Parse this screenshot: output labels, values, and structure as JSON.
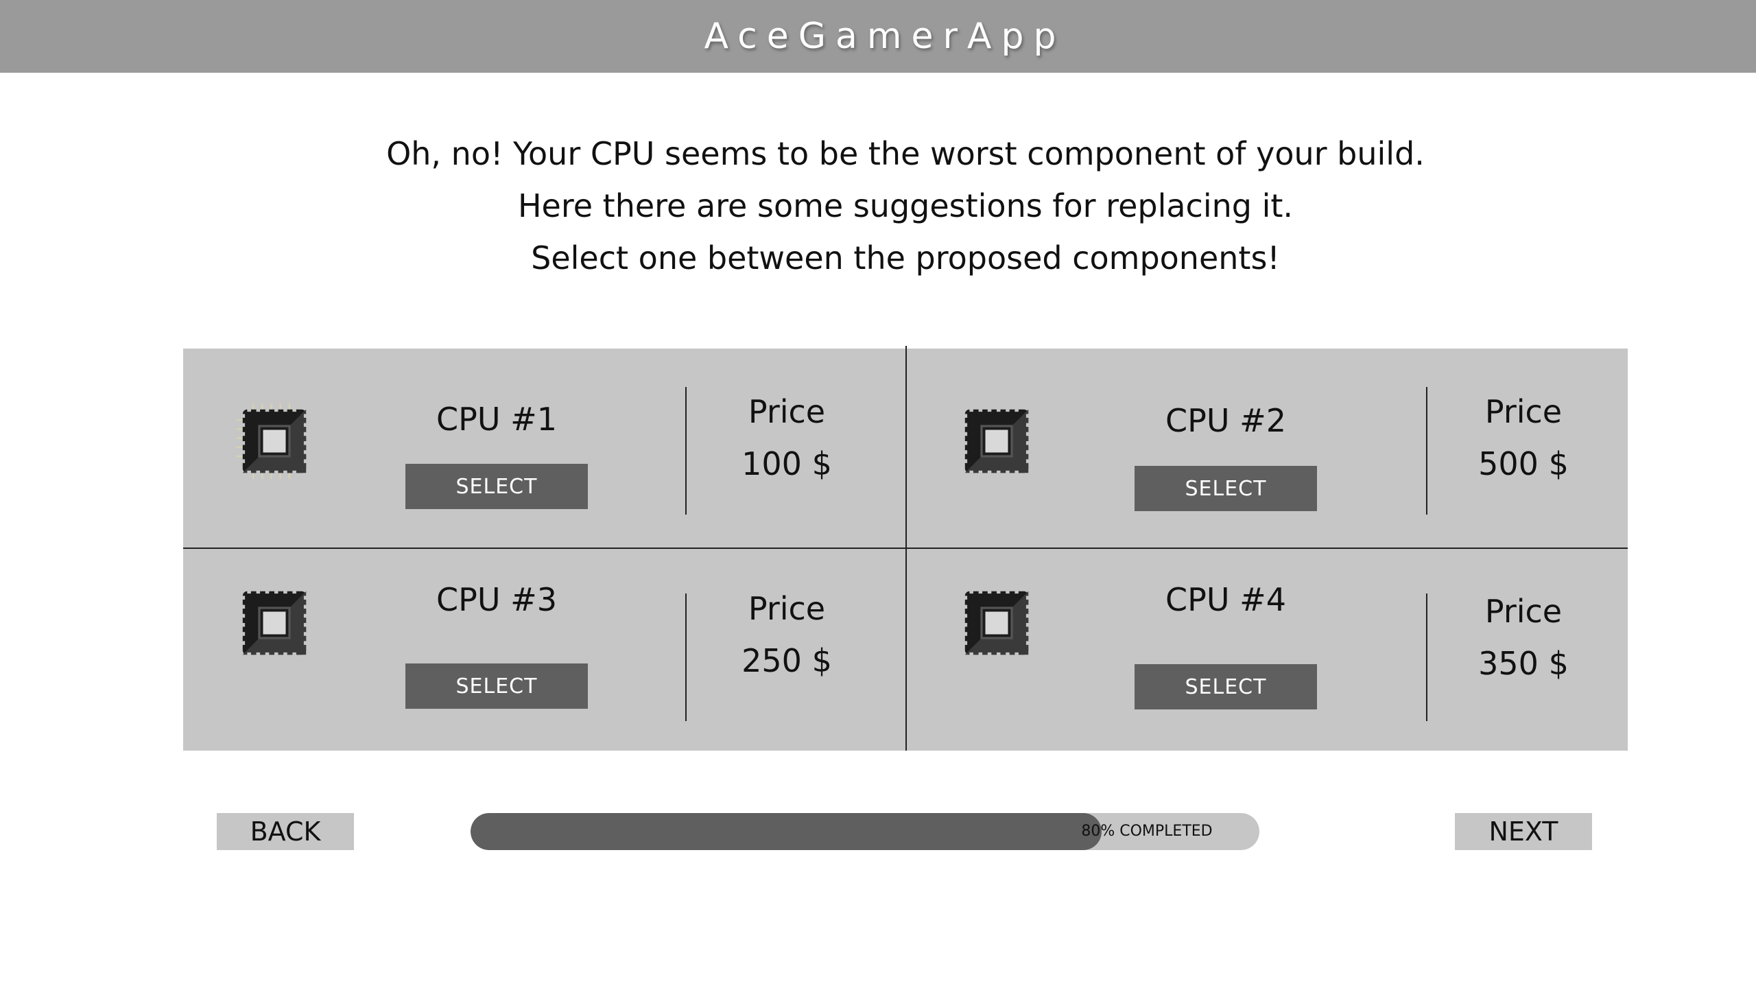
{
  "app": {
    "title": "AceGamerApp"
  },
  "message": {
    "lines": [
      "Oh, no! Your CPU seems to be the worst component of your build.",
      "Here there are some suggestions for replacing it.",
      "Select one between the proposed components!"
    ]
  },
  "options": [
    {
      "name": "CPU #1",
      "select_label": "SELECT",
      "price_label": "Price",
      "price": "100 $",
      "icon": "cpu-chip-icon"
    },
    {
      "name": "CPU #2",
      "select_label": "SELECT",
      "price_label": "Price",
      "price": "500 $",
      "icon": "cpu-chip-icon"
    },
    {
      "name": "CPU #3",
      "select_label": "SELECT",
      "price_label": "Price",
      "price": "250 $",
      "icon": "cpu-chip-icon"
    },
    {
      "name": "CPU #4",
      "select_label": "SELECT",
      "price_label": "Price",
      "price": "350 $",
      "icon": "cpu-chip-icon"
    }
  ],
  "navigation": {
    "back_label": "BACK",
    "next_label": "NEXT"
  },
  "progress": {
    "percent": 80,
    "label": "80% COMPLETED"
  },
  "colors": {
    "header": "#9a9a9a",
    "panel": "#c6c6c6",
    "button_dark": "#5f5f5f",
    "progress_fill": "#5f5f5f",
    "progress_track": "#c6c6c6"
  }
}
